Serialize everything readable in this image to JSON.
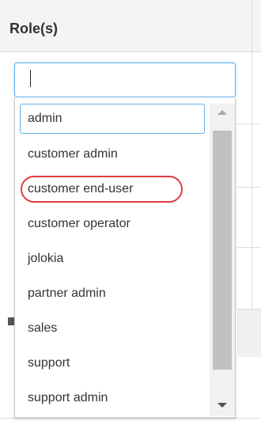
{
  "header": {
    "title": "Role(s)"
  },
  "search": {
    "value": "",
    "placeholder": ""
  },
  "dropdown": {
    "options": [
      "admin",
      "customer admin",
      "customer end-user",
      "customer operator",
      "jolokia",
      "partner admin",
      "sales",
      "support",
      "support admin"
    ],
    "highlighted_index": 0,
    "circled_index": 2
  },
  "colors": {
    "focus_border": "#66afe9",
    "circle_mark": "#e03c3c",
    "scroll_thumb": "#c1c1c1"
  }
}
